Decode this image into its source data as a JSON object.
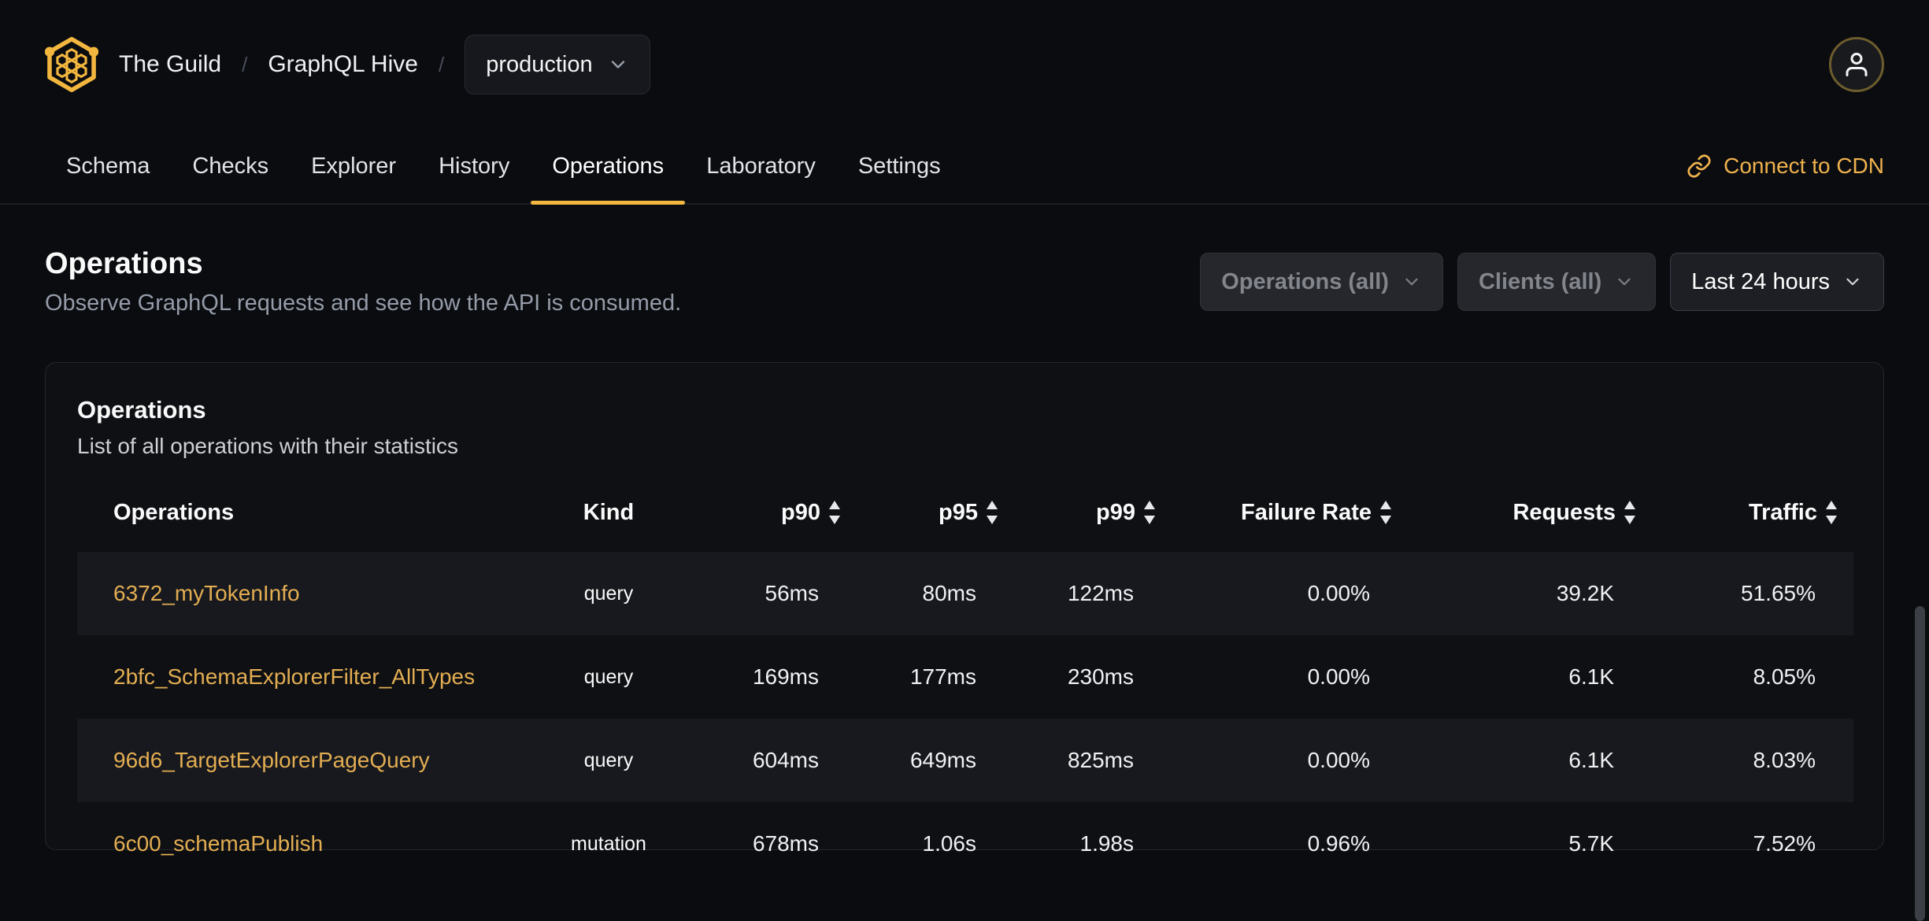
{
  "header": {
    "org": "The Guild",
    "project": "GraphQL Hive",
    "separator": "/",
    "target": "production"
  },
  "nav": {
    "tabs": [
      {
        "label": "Schema",
        "active": false
      },
      {
        "label": "Checks",
        "active": false
      },
      {
        "label": "Explorer",
        "active": false
      },
      {
        "label": "History",
        "active": false
      },
      {
        "label": "Operations",
        "active": true
      },
      {
        "label": "Laboratory",
        "active": false
      },
      {
        "label": "Settings",
        "active": false
      }
    ],
    "cdn_label": "Connect to CDN"
  },
  "page": {
    "title": "Operations",
    "subtitle": "Observe GraphQL requests and see how the API is consumed.",
    "filters": [
      {
        "label": "Operations (all)",
        "disabled": true
      },
      {
        "label": "Clients (all)",
        "disabled": true
      },
      {
        "label": "Last 24 hours",
        "disabled": false
      }
    ]
  },
  "card": {
    "title": "Operations",
    "subtitle": "List of all operations with their statistics"
  },
  "table": {
    "columns": [
      {
        "label": "Operations",
        "key": "operation",
        "sortable": false,
        "align": "left"
      },
      {
        "label": "Kind",
        "key": "kind",
        "sortable": false,
        "align": "center"
      },
      {
        "label": "p90",
        "key": "p90",
        "sortable": true,
        "align": "right"
      },
      {
        "label": "p95",
        "key": "p95",
        "sortable": true,
        "align": "right"
      },
      {
        "label": "p99",
        "key": "p99",
        "sortable": true,
        "align": "right"
      },
      {
        "label": "Failure Rate",
        "key": "failure_rate",
        "sortable": true,
        "align": "right"
      },
      {
        "label": "Requests",
        "key": "requests",
        "sortable": true,
        "align": "right"
      },
      {
        "label": "Traffic",
        "key": "traffic",
        "sortable": true,
        "align": "right"
      }
    ],
    "rows": [
      {
        "operation": "6372_myTokenInfo",
        "kind": "query",
        "p90": "56ms",
        "p95": "80ms",
        "p99": "122ms",
        "failure_rate": "0.00%",
        "requests": "39.2K",
        "traffic": "51.65%"
      },
      {
        "operation": "2bfc_SchemaExplorerFilter_AllTypes",
        "kind": "query",
        "p90": "169ms",
        "p95": "177ms",
        "p99": "230ms",
        "failure_rate": "0.00%",
        "requests": "6.1K",
        "traffic": "8.05%"
      },
      {
        "operation": "96d6_TargetExplorerPageQuery",
        "kind": "query",
        "p90": "604ms",
        "p95": "649ms",
        "p99": "825ms",
        "failure_rate": "0.00%",
        "requests": "6.1K",
        "traffic": "8.03%"
      },
      {
        "operation": "6c00_schemaPublish",
        "kind": "mutation",
        "p90": "678ms",
        "p95": "1.06s",
        "p99": "1.98s",
        "failure_rate": "0.96%",
        "requests": "5.7K",
        "traffic": "7.52%"
      }
    ]
  },
  "icons": {
    "logo": "hive-hexagon-logo",
    "user": "user-icon",
    "chevron": "chevron-down-icon",
    "link": "link-icon",
    "sort": "sort-arrows-icon"
  },
  "colors": {
    "accent_gold": "#f3b73f",
    "link_gold": "#e3ad52",
    "cdn_gold": "#f0b24e",
    "page_bg": "#0a0c10",
    "card_bg": "#0e1014",
    "row_alt_bg": "#17191e",
    "muted_text": "#959ca8"
  }
}
